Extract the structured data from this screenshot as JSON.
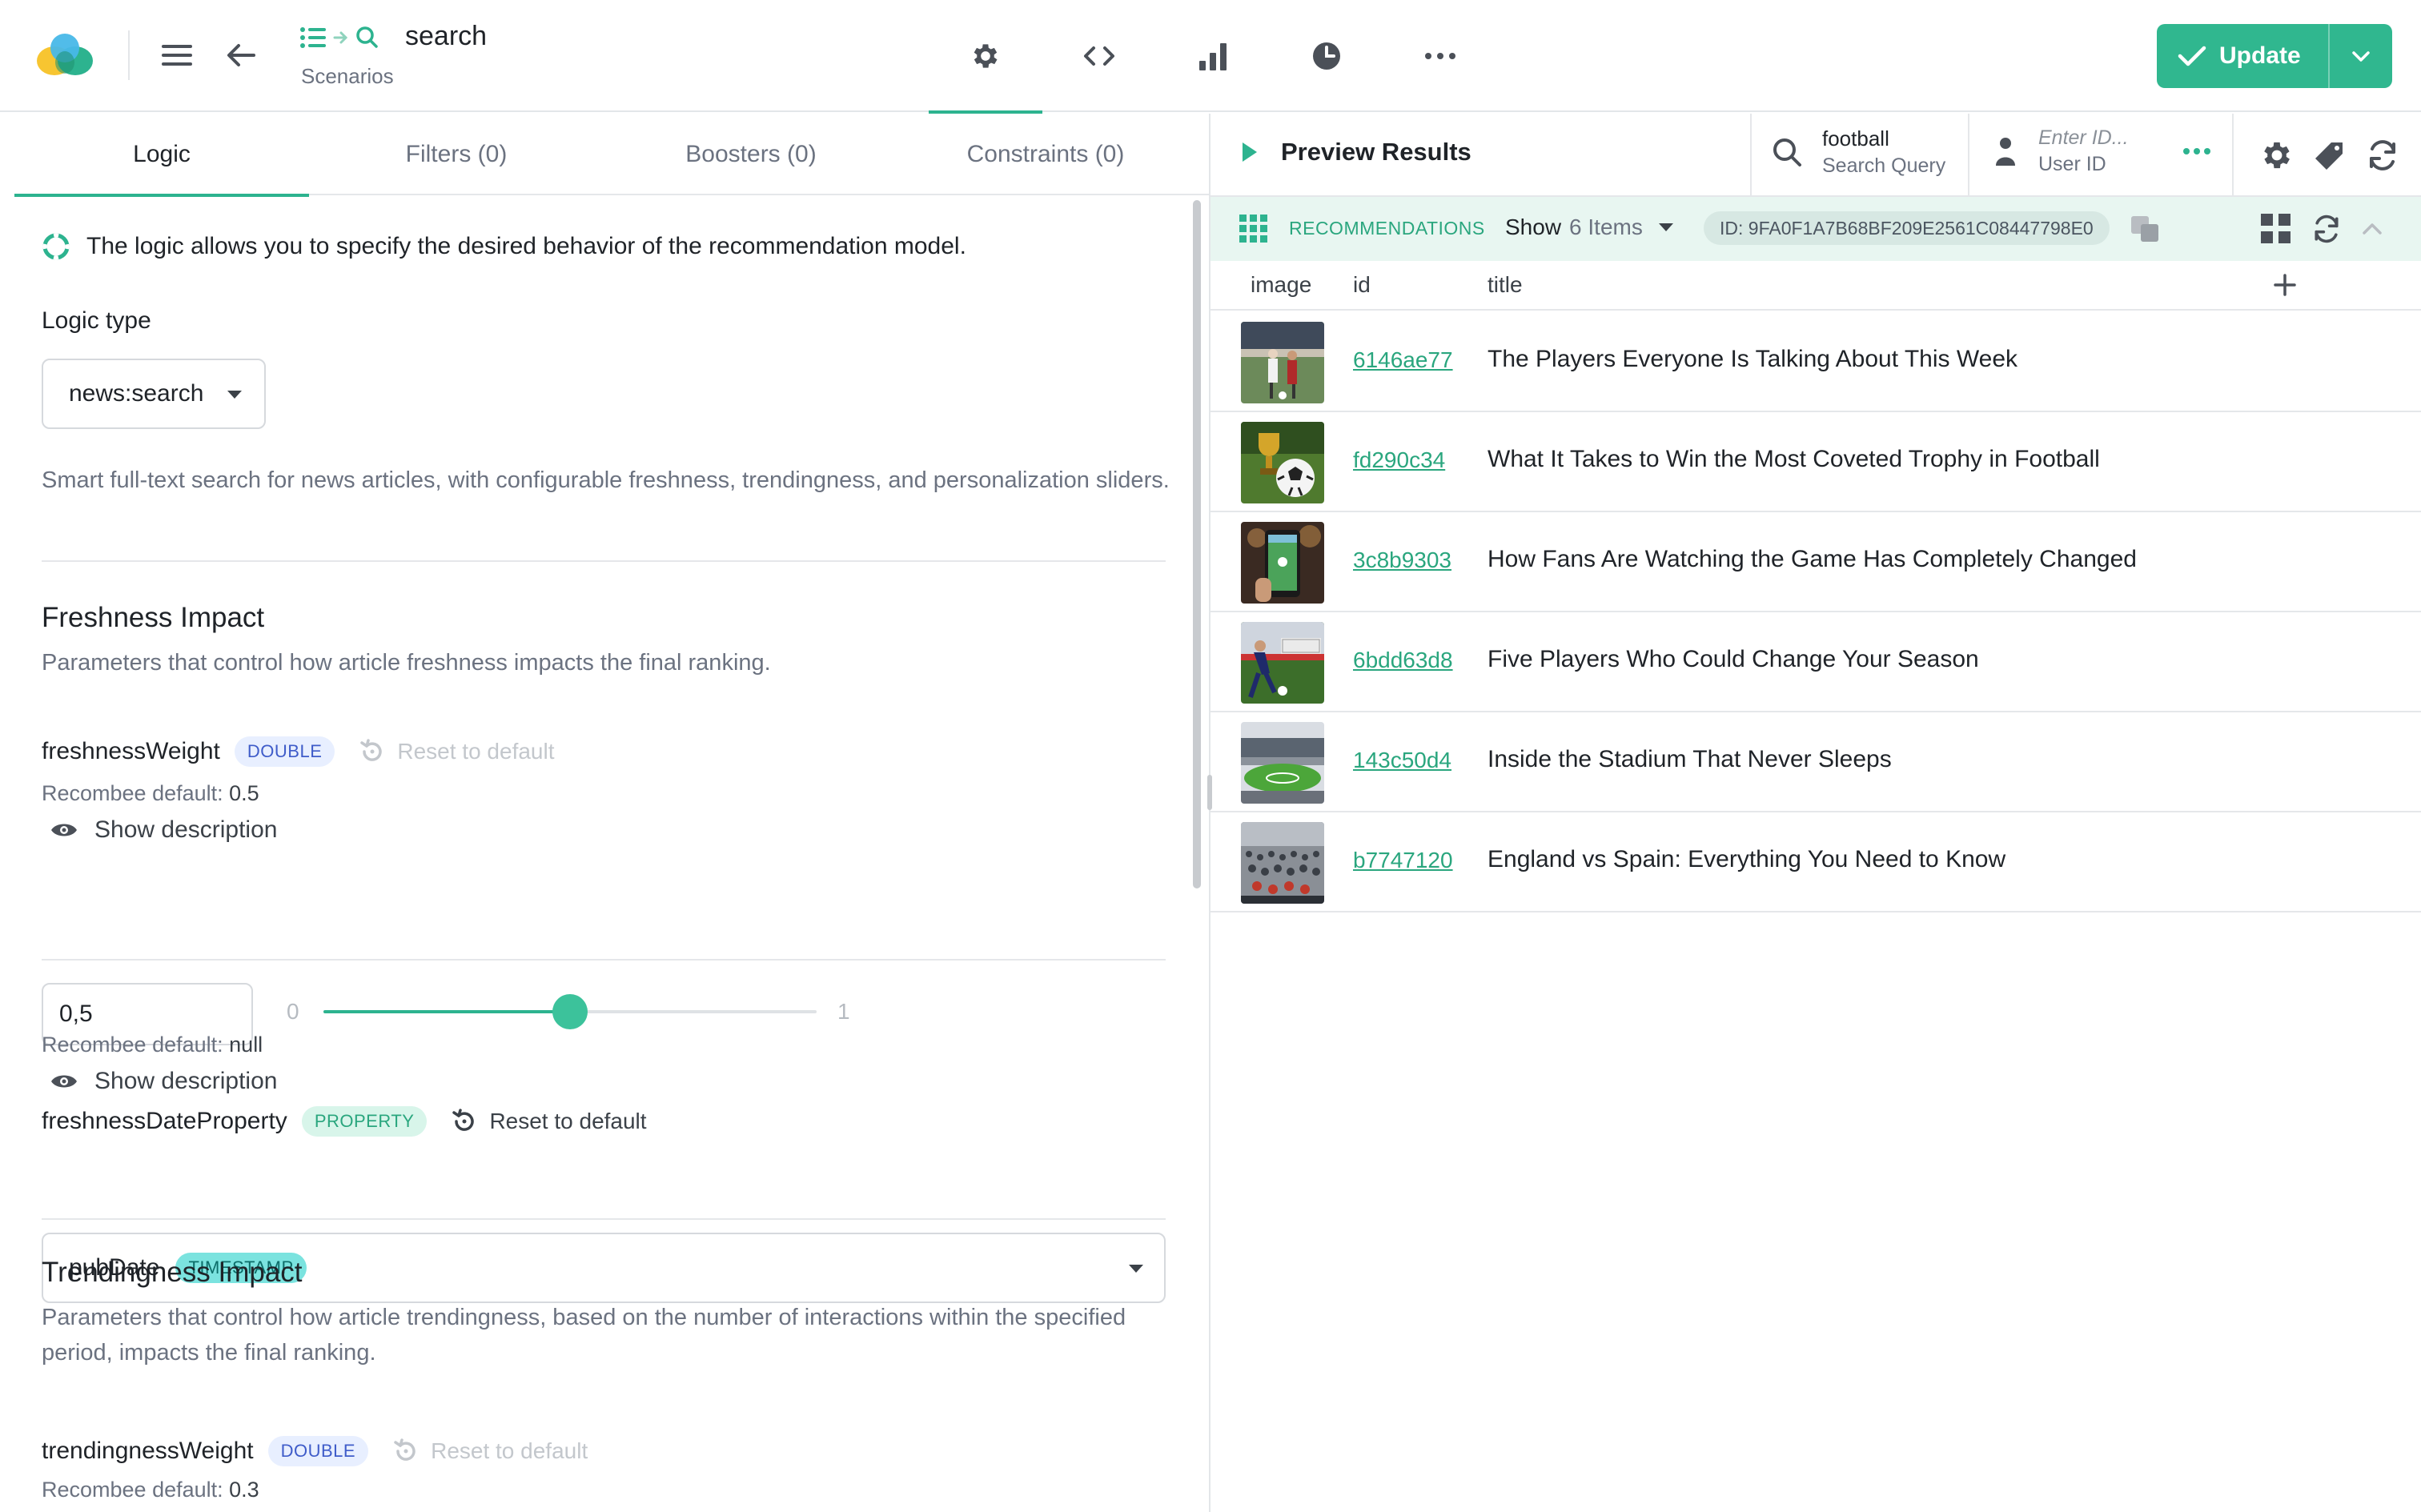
{
  "header": {
    "title": "search",
    "subtitle": "Scenarios",
    "center_tabs": [
      {
        "icon": "gear-icon",
        "active": true
      },
      {
        "icon": "code-icon",
        "active": false
      },
      {
        "icon": "bar-chart-icon",
        "active": false
      },
      {
        "icon": "clock-icon",
        "active": false
      },
      {
        "icon": "more-icon",
        "active": false
      }
    ],
    "update_label": "Update",
    "accent_color": "#30b78f"
  },
  "left": {
    "tabs": [
      "Logic",
      "Filters (0)",
      "Boosters (0)",
      "Constraints (0)"
    ],
    "info": "The logic allows you to specify the desired behavior of the recommendation model.",
    "logic_type_label": "Logic type",
    "logic_type_value": "news:search",
    "logic_desc": "Smart full-text search for news articles, with configurable freshness, trendingness, and personalization sliders.",
    "freshness": {
      "title": "Freshness Impact",
      "desc": "Parameters that control how article freshness impacts the final ranking.",
      "weight": {
        "name": "freshnessWeight",
        "type": "DOUBLE",
        "reset": "Reset to default",
        "default_label": "Recombee default:",
        "default_value": "0.5",
        "show_desc": "Show description",
        "input_value": "0,5",
        "min": "0",
        "max": "1",
        "level": 0.5
      },
      "date_property": {
        "name": "freshnessDateProperty",
        "type": "PROPERTY",
        "reset": "Reset to default",
        "default_label": "Recombee default:",
        "default_value": "null",
        "show_desc": "Show description",
        "selected": "pubDate",
        "selected_type": "TIMESTAMP"
      }
    },
    "trendingness": {
      "title": "Trendingness Impact",
      "desc": "Parameters that control how article trendingness, based on the number of interactions within the specified period, impacts the final ranking.",
      "weight": {
        "name": "trendingnessWeight",
        "type": "DOUBLE",
        "reset": "Reset to default",
        "default_label": "Recombee default:",
        "default_value": "0.3"
      }
    }
  },
  "right": {
    "preview_label": "Preview Results",
    "search_query_value": "football",
    "search_query_label": "Search Query",
    "user_id_placeholder": "Enter ID...",
    "user_id_label": "User ID",
    "reco_label": "RECOMMENDATIONS",
    "show_label": "Show",
    "items_label": "6 Items",
    "recomm_id": "ID: 9FA0F1A7B68BF209E2561C08447798E0",
    "columns": [
      "image",
      "id",
      "title"
    ],
    "rows": [
      {
        "id": "6146ae77",
        "title": "The Players Everyone Is Talking About This Week",
        "thumb": "players"
      },
      {
        "id": "fd290c34",
        "title": "What It Takes to Win the Most Coveted Trophy in Football",
        "thumb": "trophy"
      },
      {
        "id": "3c8b9303",
        "title": "How Fans Are Watching the Game Has Completely Changed",
        "thumb": "phone"
      },
      {
        "id": "6bdd63d8",
        "title": "Five Players Who Could Change Your Season",
        "thumb": "kick"
      },
      {
        "id": "143c50d4",
        "title": "Inside the Stadium That Never Sleeps",
        "thumb": "stadium"
      },
      {
        "id": "b7747120",
        "title": "England vs Spain: Everything You Need to Know",
        "thumb": "crowd"
      }
    ]
  }
}
